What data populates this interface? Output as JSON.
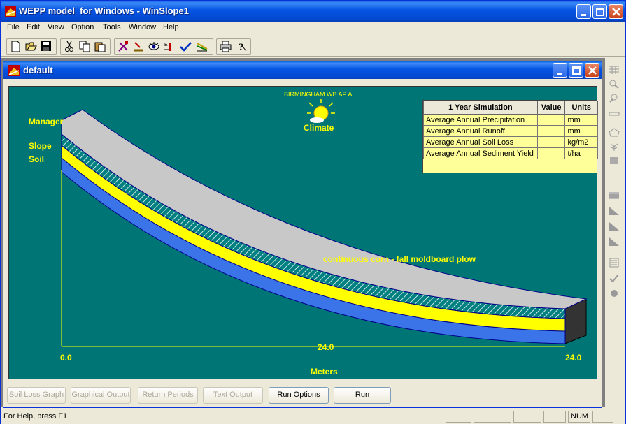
{
  "app": {
    "title": "WEPP model  for Windows - WinSlope1"
  },
  "menu": [
    "File",
    "Edit",
    "View",
    "Option",
    "Tools",
    "Window",
    "Help"
  ],
  "child": {
    "title": "default"
  },
  "scene": {
    "climate_station": "BIRMINGHAM WB AP AL",
    "climate_label": "Climate",
    "management_label": "Manager",
    "slope_label": "Slope",
    "soil_label": "Soil",
    "management_name": "continuous corn - fall moldboard plow",
    "x_start": "0.0",
    "x_mid": "24.0",
    "x_end": "24.0",
    "x_axis_label": "Meters",
    "colors": {
      "background": "#007575",
      "top_surface": "#c0c0c0",
      "hatch_layer": "#008080",
      "yellow_layer": "#ffff00",
      "blue_layer": "#3a74e8",
      "label": "#ffff00"
    }
  },
  "results": {
    "headers": [
      "1 Year Simulation",
      "Value",
      "Units"
    ],
    "rows": [
      {
        "label": "Average Annual Precipitation",
        "value": "",
        "unit": "mm"
      },
      {
        "label": "Average Annual Runoff",
        "value": "",
        "unit": "mm"
      },
      {
        "label": "Average Annual Soil Loss",
        "value": "",
        "unit": "kg/m2"
      },
      {
        "label": "Average Annual Sediment Yield",
        "value": "",
        "unit": "t/ha"
      }
    ]
  },
  "buttons": {
    "soil_loss_graph": "Soil Loss Graph",
    "graphical_output": "Graphical Output",
    "return_periods": "Return Periods",
    "text_output": "Text Output",
    "run_options": "Run Options",
    "run": "Run"
  },
  "status": {
    "help_text": "For Help, press F1",
    "num": "NUM"
  },
  "toolbar_icons": [
    "new-icon",
    "open-icon",
    "save-icon",
    "cut-icon",
    "copy-icon",
    "paste-icon",
    "tools-icon",
    "import-icon",
    "view-icon",
    "edit-icon",
    "check-icon",
    "chart-icon",
    "print-icon",
    "help-icon"
  ],
  "right_toolbar_icons": [
    "grid-icon",
    "zoom-in-icon",
    "zoom-out-icon",
    "ruler-icon",
    "polygon-icon",
    "plant-icon",
    "rectangle-icon",
    "blank-icon",
    "layers-icon",
    "slope-icon",
    "slope2-icon",
    "slope3-icon",
    "list-icon",
    "check-icon",
    "dot-icon"
  ]
}
